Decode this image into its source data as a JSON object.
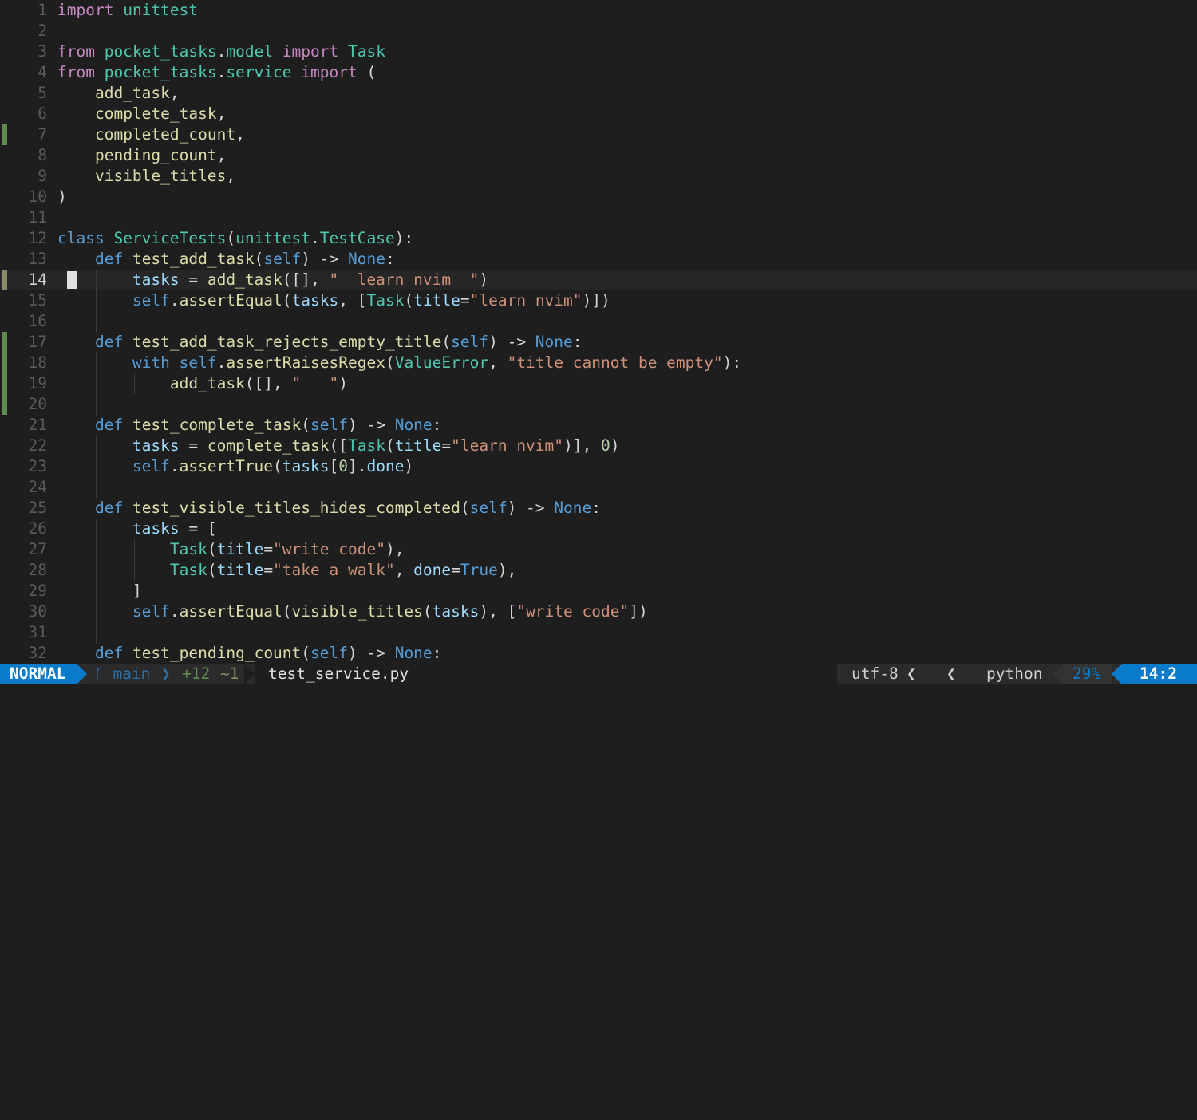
{
  "editor": {
    "cursor_line": 14,
    "lines": [
      {
        "n": "1",
        "sign": "",
        "tokens": [
          {
            "c": "k",
            "t": "import"
          },
          {
            "c": "p",
            "t": " "
          },
          {
            "c": "m",
            "t": "unittest"
          }
        ]
      },
      {
        "n": "2",
        "sign": "",
        "tokens": []
      },
      {
        "n": "3",
        "sign": "",
        "tokens": [
          {
            "c": "k",
            "t": "from"
          },
          {
            "c": "p",
            "t": " "
          },
          {
            "c": "m",
            "t": "pocket_tasks"
          },
          {
            "c": "p",
            "t": "."
          },
          {
            "c": "m",
            "t": "model"
          },
          {
            "c": "p",
            "t": " "
          },
          {
            "c": "k",
            "t": "import"
          },
          {
            "c": "p",
            "t": " "
          },
          {
            "c": "m",
            "t": "Task"
          }
        ]
      },
      {
        "n": "4",
        "sign": "",
        "tokens": [
          {
            "c": "k",
            "t": "from"
          },
          {
            "c": "p",
            "t": " "
          },
          {
            "c": "m",
            "t": "pocket_tasks"
          },
          {
            "c": "p",
            "t": "."
          },
          {
            "c": "m",
            "t": "service"
          },
          {
            "c": "p",
            "t": " "
          },
          {
            "c": "k",
            "t": "import"
          },
          {
            "c": "p",
            "t": " ("
          }
        ]
      },
      {
        "n": "5",
        "sign": "",
        "tokens": [
          {
            "c": "p",
            "t": "    "
          },
          {
            "c": "f",
            "t": "add_task"
          },
          {
            "c": "p",
            "t": ","
          }
        ]
      },
      {
        "n": "6",
        "sign": "",
        "tokens": [
          {
            "c": "p",
            "t": "    "
          },
          {
            "c": "f",
            "t": "complete_task"
          },
          {
            "c": "p",
            "t": ","
          }
        ]
      },
      {
        "n": "7",
        "sign": "add",
        "tokens": [
          {
            "c": "p",
            "t": "    "
          },
          {
            "c": "f",
            "t": "completed_count"
          },
          {
            "c": "p",
            "t": ","
          }
        ]
      },
      {
        "n": "8",
        "sign": "",
        "tokens": [
          {
            "c": "p",
            "t": "    "
          },
          {
            "c": "f",
            "t": "pending_count"
          },
          {
            "c": "p",
            "t": ","
          }
        ]
      },
      {
        "n": "9",
        "sign": "",
        "tokens": [
          {
            "c": "p",
            "t": "    "
          },
          {
            "c": "f",
            "t": "visible_titles"
          },
          {
            "c": "p",
            "t": ","
          }
        ]
      },
      {
        "n": "10",
        "sign": "",
        "tokens": [
          {
            "c": "p",
            "t": ")"
          }
        ]
      },
      {
        "n": "11",
        "sign": "",
        "tokens": []
      },
      {
        "n": "12",
        "sign": "",
        "tokens": [
          {
            "c": "kb",
            "t": "class"
          },
          {
            "c": "p",
            "t": " "
          },
          {
            "c": "m",
            "t": "ServiceTests"
          },
          {
            "c": "p",
            "t": "("
          },
          {
            "c": "m",
            "t": "unittest"
          },
          {
            "c": "p",
            "t": "."
          },
          {
            "c": "m",
            "t": "TestCase"
          },
          {
            "c": "p",
            "t": "):"
          }
        ]
      },
      {
        "n": "13",
        "sign": "",
        "tokens": [
          {
            "c": "p",
            "t": "    "
          },
          {
            "c": "kb",
            "t": "def"
          },
          {
            "c": "p",
            "t": " "
          },
          {
            "c": "f",
            "t": "test_add_task"
          },
          {
            "c": "p",
            "t": "("
          },
          {
            "c": "kb",
            "t": "self"
          },
          {
            "c": "p",
            "t": ") -> "
          },
          {
            "c": "kb",
            "t": "None"
          },
          {
            "c": "p",
            "t": ":"
          }
        ]
      },
      {
        "n": "14",
        "sign": "cur",
        "tokens": [
          {
            "c": "p",
            "t": "        "
          },
          {
            "c": "v",
            "t": "tasks"
          },
          {
            "c": "p",
            "t": " = "
          },
          {
            "c": "f",
            "t": "add_task"
          },
          {
            "c": "p",
            "t": "([], "
          },
          {
            "c": "s",
            "t": "\"  learn nvim  \""
          },
          {
            "c": "p",
            "t": ")"
          }
        ]
      },
      {
        "n": "15",
        "sign": "",
        "tokens": [
          {
            "c": "p",
            "t": "        "
          },
          {
            "c": "kb",
            "t": "self"
          },
          {
            "c": "p",
            "t": "."
          },
          {
            "c": "f",
            "t": "assertEqual"
          },
          {
            "c": "p",
            "t": "("
          },
          {
            "c": "v",
            "t": "tasks"
          },
          {
            "c": "p",
            "t": ", ["
          },
          {
            "c": "m",
            "t": "Task"
          },
          {
            "c": "p",
            "t": "("
          },
          {
            "c": "v",
            "t": "title"
          },
          {
            "c": "p",
            "t": "="
          },
          {
            "c": "s",
            "t": "\"learn nvim\""
          },
          {
            "c": "p",
            "t": ")])"
          }
        ]
      },
      {
        "n": "16",
        "sign": "",
        "tokens": []
      },
      {
        "n": "17",
        "sign": "add",
        "tokens": [
          {
            "c": "p",
            "t": "    "
          },
          {
            "c": "kb",
            "t": "def"
          },
          {
            "c": "p",
            "t": " "
          },
          {
            "c": "f",
            "t": "test_add_task_rejects_empty_title"
          },
          {
            "c": "p",
            "t": "("
          },
          {
            "c": "kb",
            "t": "self"
          },
          {
            "c": "p",
            "t": ") -> "
          },
          {
            "c": "kb",
            "t": "None"
          },
          {
            "c": "p",
            "t": ":"
          }
        ]
      },
      {
        "n": "18",
        "sign": "add",
        "tokens": [
          {
            "c": "p",
            "t": "        "
          },
          {
            "c": "kb",
            "t": "with"
          },
          {
            "c": "p",
            "t": " "
          },
          {
            "c": "kb",
            "t": "self"
          },
          {
            "c": "p",
            "t": "."
          },
          {
            "c": "f",
            "t": "assertRaisesRegex"
          },
          {
            "c": "p",
            "t": "("
          },
          {
            "c": "m",
            "t": "ValueError"
          },
          {
            "c": "p",
            "t": ", "
          },
          {
            "c": "s",
            "t": "\"title cannot be empty\""
          },
          {
            "c": "p",
            "t": "):"
          }
        ]
      },
      {
        "n": "19",
        "sign": "add",
        "tokens": [
          {
            "c": "p",
            "t": "            "
          },
          {
            "c": "f",
            "t": "add_task"
          },
          {
            "c": "p",
            "t": "([], "
          },
          {
            "c": "s",
            "t": "\"   \""
          },
          {
            "c": "p",
            "t": ")"
          }
        ]
      },
      {
        "n": "20",
        "sign": "add",
        "tokens": []
      },
      {
        "n": "21",
        "sign": "",
        "tokens": [
          {
            "c": "p",
            "t": "    "
          },
          {
            "c": "kb",
            "t": "def"
          },
          {
            "c": "p",
            "t": " "
          },
          {
            "c": "f",
            "t": "test_complete_task"
          },
          {
            "c": "p",
            "t": "("
          },
          {
            "c": "kb",
            "t": "self"
          },
          {
            "c": "p",
            "t": ") -> "
          },
          {
            "c": "kb",
            "t": "None"
          },
          {
            "c": "p",
            "t": ":"
          }
        ]
      },
      {
        "n": "22",
        "sign": "",
        "tokens": [
          {
            "c": "p",
            "t": "        "
          },
          {
            "c": "v",
            "t": "tasks"
          },
          {
            "c": "p",
            "t": " = "
          },
          {
            "c": "f",
            "t": "complete_task"
          },
          {
            "c": "p",
            "t": "(["
          },
          {
            "c": "m",
            "t": "Task"
          },
          {
            "c": "p",
            "t": "("
          },
          {
            "c": "v",
            "t": "title"
          },
          {
            "c": "p",
            "t": "="
          },
          {
            "c": "s",
            "t": "\"learn nvim\""
          },
          {
            "c": "p",
            "t": ")], "
          },
          {
            "c": "n",
            "t": "0"
          },
          {
            "c": "p",
            "t": ")"
          }
        ]
      },
      {
        "n": "23",
        "sign": "",
        "tokens": [
          {
            "c": "p",
            "t": "        "
          },
          {
            "c": "kb",
            "t": "self"
          },
          {
            "c": "p",
            "t": "."
          },
          {
            "c": "f",
            "t": "assertTrue"
          },
          {
            "c": "p",
            "t": "("
          },
          {
            "c": "v",
            "t": "tasks"
          },
          {
            "c": "p",
            "t": "["
          },
          {
            "c": "n",
            "t": "0"
          },
          {
            "c": "p",
            "t": "]."
          },
          {
            "c": "v",
            "t": "done"
          },
          {
            "c": "p",
            "t": ")"
          }
        ]
      },
      {
        "n": "24",
        "sign": "",
        "tokens": []
      },
      {
        "n": "25",
        "sign": "",
        "tokens": [
          {
            "c": "p",
            "t": "    "
          },
          {
            "c": "kb",
            "t": "def"
          },
          {
            "c": "p",
            "t": " "
          },
          {
            "c": "f",
            "t": "test_visible_titles_hides_completed"
          },
          {
            "c": "p",
            "t": "("
          },
          {
            "c": "kb",
            "t": "self"
          },
          {
            "c": "p",
            "t": ") -> "
          },
          {
            "c": "kb",
            "t": "None"
          },
          {
            "c": "p",
            "t": ":"
          }
        ]
      },
      {
        "n": "26",
        "sign": "",
        "tokens": [
          {
            "c": "p",
            "t": "        "
          },
          {
            "c": "v",
            "t": "tasks"
          },
          {
            "c": "p",
            "t": " = ["
          }
        ]
      },
      {
        "n": "27",
        "sign": "",
        "tokens": [
          {
            "c": "p",
            "t": "            "
          },
          {
            "c": "m",
            "t": "Task"
          },
          {
            "c": "p",
            "t": "("
          },
          {
            "c": "v",
            "t": "title"
          },
          {
            "c": "p",
            "t": "="
          },
          {
            "c": "s",
            "t": "\"write code\""
          },
          {
            "c": "p",
            "t": "),"
          }
        ]
      },
      {
        "n": "28",
        "sign": "",
        "tokens": [
          {
            "c": "p",
            "t": "            "
          },
          {
            "c": "m",
            "t": "Task"
          },
          {
            "c": "p",
            "t": "("
          },
          {
            "c": "v",
            "t": "title"
          },
          {
            "c": "p",
            "t": "="
          },
          {
            "c": "s",
            "t": "\"take a walk\""
          },
          {
            "c": "p",
            "t": ", "
          },
          {
            "c": "v",
            "t": "done"
          },
          {
            "c": "p",
            "t": "="
          },
          {
            "c": "kb",
            "t": "True"
          },
          {
            "c": "p",
            "t": "),"
          }
        ]
      },
      {
        "n": "29",
        "sign": "",
        "tokens": [
          {
            "c": "p",
            "t": "        ]"
          }
        ]
      },
      {
        "n": "30",
        "sign": "",
        "tokens": [
          {
            "c": "p",
            "t": "        "
          },
          {
            "c": "kb",
            "t": "self"
          },
          {
            "c": "p",
            "t": "."
          },
          {
            "c": "f",
            "t": "assertEqual"
          },
          {
            "c": "p",
            "t": "("
          },
          {
            "c": "f",
            "t": "visible_titles"
          },
          {
            "c": "p",
            "t": "("
          },
          {
            "c": "v",
            "t": "tasks"
          },
          {
            "c": "p",
            "t": "), ["
          },
          {
            "c": "s",
            "t": "\"write code\""
          },
          {
            "c": "p",
            "t": "])"
          }
        ]
      },
      {
        "n": "31",
        "sign": "",
        "tokens": []
      },
      {
        "n": "32",
        "sign": "",
        "tokens": [
          {
            "c": "p",
            "t": "    "
          },
          {
            "c": "kb",
            "t": "def"
          },
          {
            "c": "p",
            "t": " "
          },
          {
            "c": "f",
            "t": "test_pending_count"
          },
          {
            "c": "p",
            "t": "("
          },
          {
            "c": "kb",
            "t": "self"
          },
          {
            "c": "p",
            "t": ") -> "
          },
          {
            "c": "kb",
            "t": "None"
          },
          {
            "c": "p",
            "t": ":"
          }
        ]
      }
    ]
  },
  "statusline": {
    "mode": "NORMAL",
    "branch_icon": "git-branch-icon",
    "branch": "main",
    "diff_added": "+12",
    "diff_modified": "~1",
    "filename": "test_service.py",
    "encoding": "utf-8",
    "separator": "❮",
    "os_icon": "linux-tux-icon",
    "filetype_icon": "python-icon",
    "filetype": "python",
    "percent": "29%",
    "position": "14:2"
  },
  "colors": {
    "background": "#1e1e1e",
    "mode_bg": "#0a7aca",
    "git_added": "#608b4e",
    "keyword": "#c586c0",
    "builtin": "#569cd6",
    "module": "#4ec9b0",
    "function": "#dcdcaa",
    "string": "#ce9178"
  }
}
